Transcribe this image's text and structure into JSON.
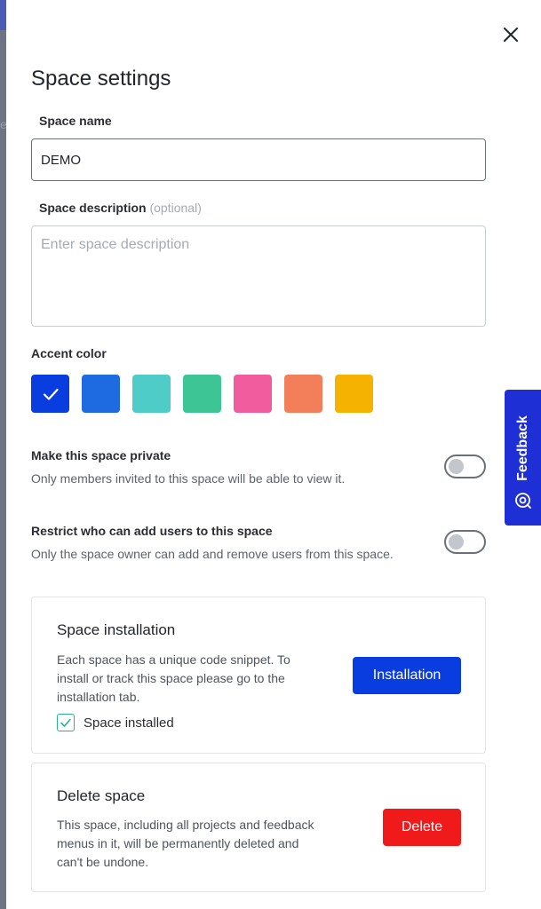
{
  "panel": {
    "title": "Space settings"
  },
  "form": {
    "name_label": "Space name",
    "name_value": "DEMO",
    "description_label": "Space description",
    "description_optional": "(optional)",
    "description_placeholder": "Enter space description"
  },
  "accent": {
    "label": "Accent color",
    "selected_index": 0,
    "colors": [
      "#0a3de0",
      "#1e6ae1",
      "#4ecdc8",
      "#3ec596",
      "#f05c9d",
      "#f27f5a",
      "#f5b300"
    ]
  },
  "settings": {
    "private": {
      "title": "Make this space private",
      "desc": "Only members invited to this space will be able to view it.",
      "enabled": false
    },
    "restrict": {
      "title": "Restrict who can add users to this space",
      "desc": "Only the space owner can add and remove users from this space.",
      "enabled": false
    }
  },
  "installation": {
    "title": "Space installation",
    "text": "Each space has a unique code snippet. To install or track this space please go to the installation tab.",
    "button": "Installation",
    "checkbox_label": "Space installed",
    "checked": true
  },
  "delete": {
    "title": "Delete space",
    "text": "This space, including all projects and feedback menus in it, will be permanently deleted and can't be undone.",
    "button": "Delete"
  },
  "feedback_tab": {
    "label": "Feedback"
  },
  "backdrop": {
    "letter": "e"
  }
}
